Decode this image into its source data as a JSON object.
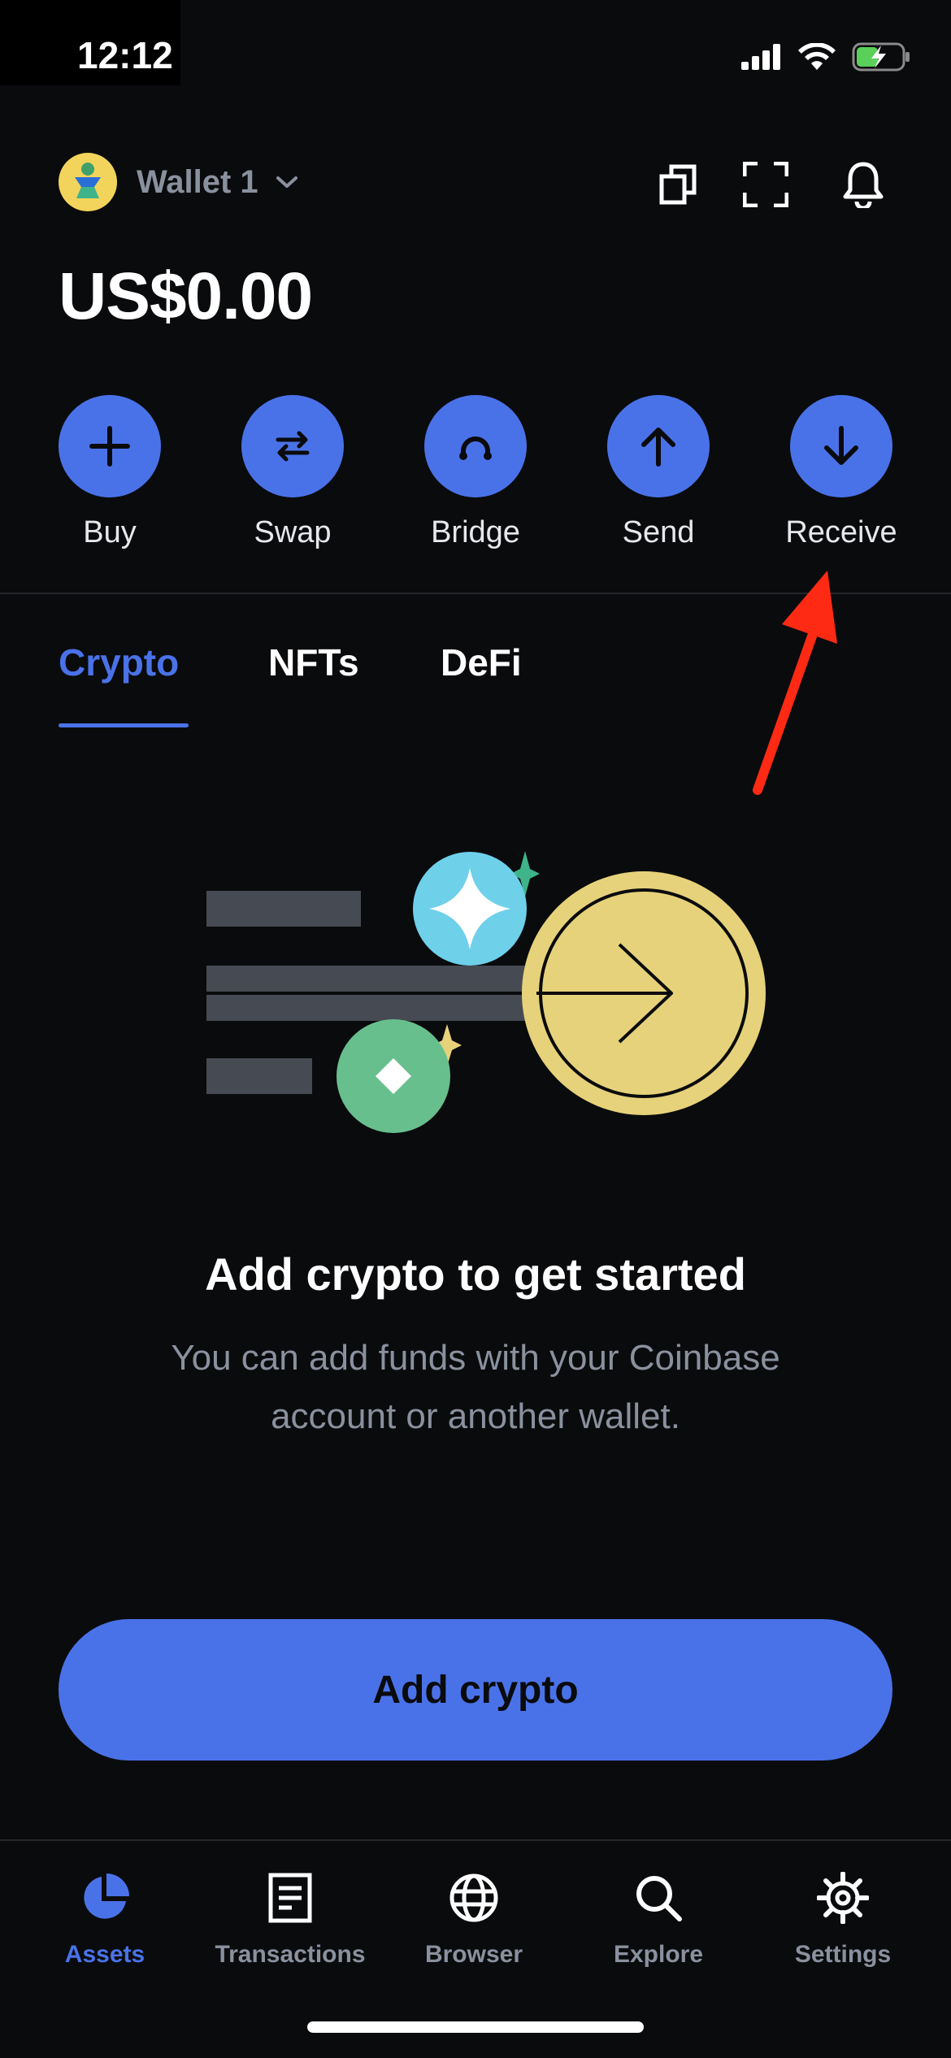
{
  "status_bar": {
    "time": "12:12"
  },
  "header": {
    "wallet_name": "Wallet 1",
    "balance": "US$0.00"
  },
  "actions": [
    {
      "label": "Buy",
      "icon": "plus-icon"
    },
    {
      "label": "Swap",
      "icon": "swap-icon"
    },
    {
      "label": "Bridge",
      "icon": "bridge-icon"
    },
    {
      "label": "Send",
      "icon": "arrow-up-icon"
    },
    {
      "label": "Receive",
      "icon": "arrow-down-icon"
    }
  ],
  "tabs": [
    {
      "label": "Crypto",
      "active": true
    },
    {
      "label": "NFTs",
      "active": false
    },
    {
      "label": "DeFi",
      "active": false
    }
  ],
  "empty_state": {
    "title": "Add crypto to get started",
    "subtitle": "You can add funds with your Coinbase account or another wallet."
  },
  "cta": {
    "label": "Add crypto"
  },
  "nav": [
    {
      "label": "Assets",
      "icon": "pie-chart-icon",
      "active": true
    },
    {
      "label": "Transactions",
      "icon": "document-icon",
      "active": false
    },
    {
      "label": "Browser",
      "icon": "globe-icon",
      "active": false
    },
    {
      "label": "Explore",
      "icon": "search-icon",
      "active": false
    },
    {
      "label": "Settings",
      "icon": "gear-icon",
      "active": false
    }
  ],
  "colors": {
    "background": "#0a0b0d",
    "accent": "#4a72e8",
    "muted_text": "#8a919e",
    "annotation_arrow": "#ff2a14"
  }
}
